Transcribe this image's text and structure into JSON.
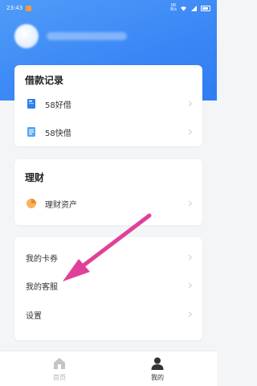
{
  "status_bar": {
    "time": "23:43",
    "network": "0K\nB/s"
  },
  "loan_records": {
    "title": "借款记录",
    "items": [
      {
        "label": "58好借",
        "icon": "book-icon",
        "color": "#2f7ff0"
      },
      {
        "label": "58快借",
        "icon": "notepad-icon",
        "color": "#56a6f5"
      }
    ]
  },
  "finance": {
    "title": "理财",
    "items": [
      {
        "label": "理财资产",
        "icon": "pie-chart-icon",
        "color": "#f39a3c"
      }
    ]
  },
  "misc": {
    "items": [
      {
        "label": "我的卡券"
      },
      {
        "label": "我的客服"
      },
      {
        "label": "设置"
      }
    ]
  },
  "bottom_nav": {
    "home_label": "首页",
    "mine_label": "我的"
  },
  "colors": {
    "header_blue": "#3a86f5",
    "annotation_arrow": "#e0409a"
  },
  "icons": {
    "home": "home-icon",
    "mine": "person-icon",
    "chevron": "chevron-right-icon"
  }
}
